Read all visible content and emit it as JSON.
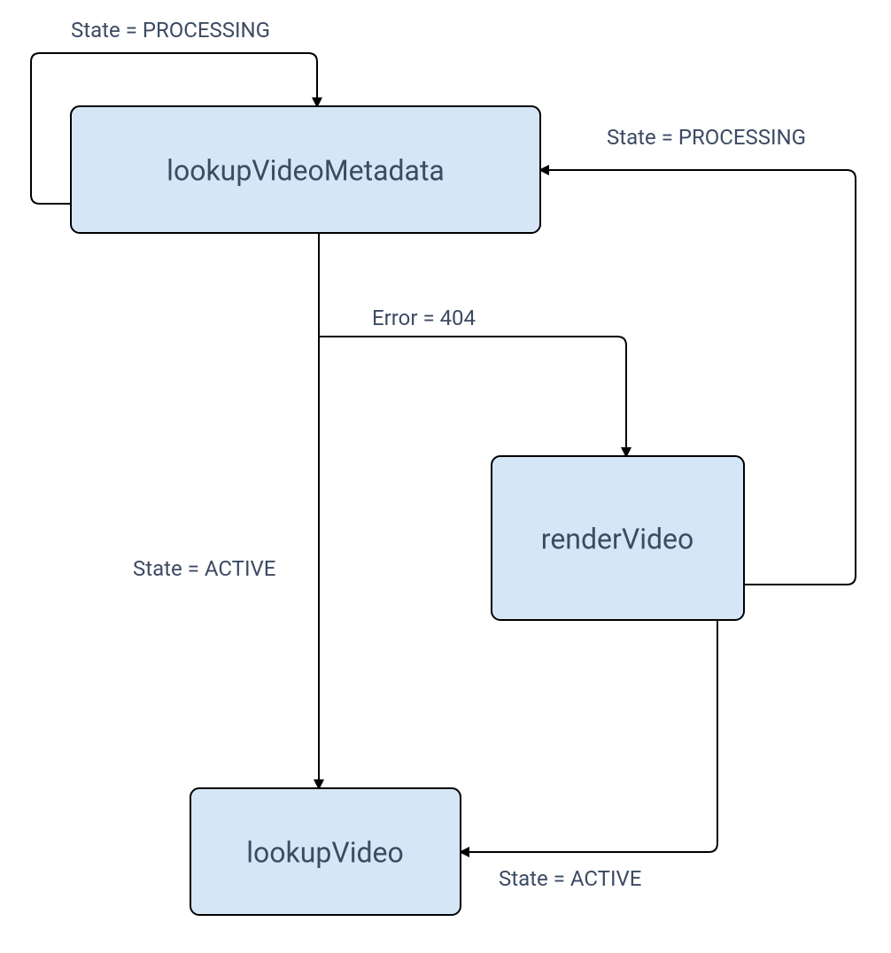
{
  "diagram": {
    "nodes": {
      "lookupVideoMetadata": {
        "label": "lookupVideoMetadata"
      },
      "renderVideo": {
        "label": "renderVideo"
      },
      "lookupVideo": {
        "label": "lookupVideo"
      }
    },
    "edges": {
      "selfLoop_lookupVideoMetadata": {
        "label": "State = PROCESSING"
      },
      "renderVideo_to_lookupVideoMetadata": {
        "label": "State = PROCESSING"
      },
      "lookupVideoMetadata_to_renderVideo": {
        "label": "Error = 404"
      },
      "lookupVideoMetadata_to_lookupVideo": {
        "label": "State = ACTIVE"
      },
      "renderVideo_to_lookupVideo": {
        "label": "State = ACTIVE"
      }
    }
  }
}
